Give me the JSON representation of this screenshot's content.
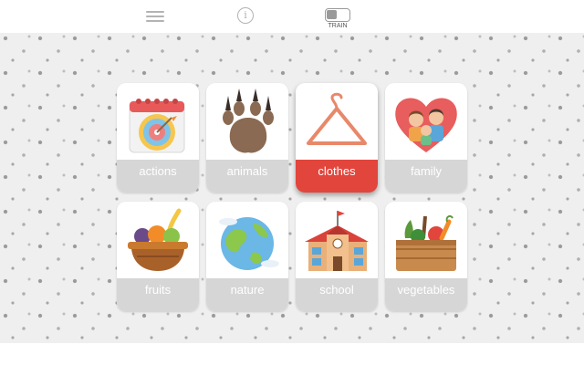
{
  "toolbar": {
    "menu_icon": "hamburger-menu-icon",
    "info_icon": "info-icon",
    "info_glyph": "i",
    "train_label": "TRAIN"
  },
  "colors": {
    "selected": "#e2453c",
    "label_bg": "#d6d6d6",
    "pattern_bg": "#efefef"
  },
  "categories": [
    {
      "label": "actions",
      "icon": "target-calendar-icon",
      "selected": false
    },
    {
      "label": "animals",
      "icon": "paw-print-icon",
      "selected": false
    },
    {
      "label": "clothes",
      "icon": "hanger-icon",
      "selected": true
    },
    {
      "label": "family",
      "icon": "family-heart-icon",
      "selected": false
    },
    {
      "label": "fruits",
      "icon": "fruit-basket-icon",
      "selected": false
    },
    {
      "label": "nature",
      "icon": "earth-globe-icon",
      "selected": false
    },
    {
      "label": "school",
      "icon": "school-building-icon",
      "selected": false
    },
    {
      "label": "vegetables",
      "icon": "vegetable-basket-icon",
      "selected": false
    }
  ]
}
